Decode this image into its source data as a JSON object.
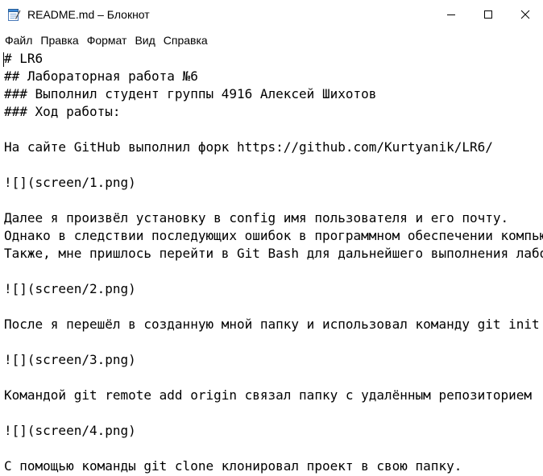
{
  "window": {
    "title": "README.md – Блокнот"
  },
  "menu": {
    "items": [
      "Файл",
      "Правка",
      "Формат",
      "Вид",
      "Справка"
    ]
  },
  "editor": {
    "lines": [
      "# LR6",
      "## Лабораторная работа №6",
      "### Выполнил студент группы 4916 Алексей Шихотов",
      "### Ход работы:",
      "",
      "На сайте GitHub выполнил форк https://github.com/Kurtyanik/LR6/",
      "",
      "![](screen/1.png)",
      "",
      "Далее я произвёл установку в config имя пользователя и его почту.",
      "Однако в следствии последующих ошибок в программном обеспечении компьютера",
      "Также, мне пришлось перейти в Git Bash для дальнейшего выполнения лабораторной",
      "",
      "![](screen/2.png)",
      "",
      "После я перешёл в созданную мной папку и использовал команду git init",
      "",
      "![](screen/3.png)",
      "",
      "Командой git remote add origin связал папку с удалённым репозиторием",
      "",
      "![](screen/4.png)",
      "",
      "С помощью команды git clone клонировал проект в свою папку."
    ]
  },
  "icons": {
    "app": "notepad-icon",
    "minimize": "minimize-icon",
    "maximize": "maximize-icon",
    "close": "close-icon"
  }
}
